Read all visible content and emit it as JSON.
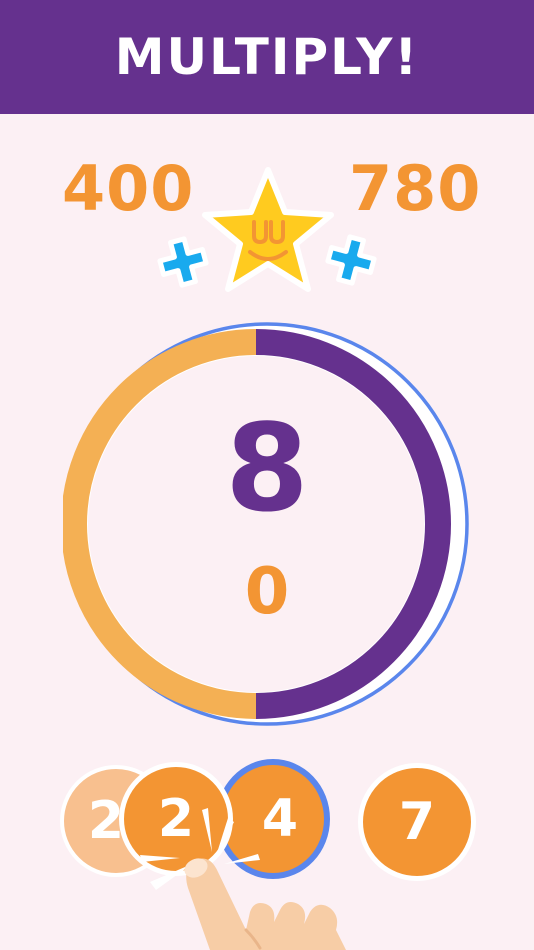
{
  "header": {
    "title": "MULTIPLY!"
  },
  "scores": {
    "left": "400",
    "right": "780"
  },
  "target": {
    "value": "8",
    "current": "0",
    "progress": 0.5
  },
  "tiles": [
    {
      "label": "2",
      "state": "faded"
    },
    {
      "label": "2",
      "state": "pressed"
    },
    {
      "label": "4",
      "state": "selected"
    },
    {
      "label": "7",
      "state": "available"
    }
  ],
  "colors": {
    "header_bg": "#65318e",
    "background": "#fcf0f4",
    "orange": "#f39533",
    "light_orange": "#f4b054",
    "purple": "#65318e",
    "blue_ring": "#5a86ec",
    "star_yellow": "#ffcb1f",
    "plus_blue": "#19aaee"
  },
  "icons": [
    "star-face-icon",
    "plus-icon",
    "pointing-hand-icon"
  ]
}
